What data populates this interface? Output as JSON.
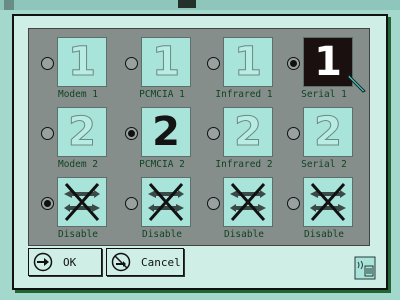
{
  "slots": [
    [
      {
        "label": "Modem 1",
        "digit": "1",
        "selected": false,
        "style": "outline"
      },
      {
        "label": "PCMCIA 1",
        "digit": "1",
        "selected": false,
        "style": "outline"
      },
      {
        "label": "Infrared 1",
        "digit": "1",
        "selected": false,
        "style": "outline"
      },
      {
        "label": "Serial 1",
        "digit": "1",
        "selected": true,
        "style": "highlighted"
      }
    ],
    [
      {
        "label": "Modem 2",
        "digit": "2",
        "selected": false,
        "style": "outline"
      },
      {
        "label": "PCMCIA 2",
        "digit": "2",
        "selected": true,
        "style": "solid"
      },
      {
        "label": "Infrared 2",
        "digit": "2",
        "selected": false,
        "style": "outline"
      },
      {
        "label": "Serial 2",
        "digit": "2",
        "selected": false,
        "style": "outline"
      }
    ],
    [
      {
        "label": "Disable",
        "selected": true,
        "icon": "disabled-port-icon"
      },
      {
        "label": "Disable",
        "selected": false,
        "icon": "disabled-port-icon"
      },
      {
        "label": "Disable",
        "selected": false,
        "icon": "disabled-port-icon"
      },
      {
        "label": "Disable",
        "selected": false,
        "icon": "disabled-port-icon"
      }
    ]
  ],
  "buttons": {
    "ok": {
      "label": "OK",
      "icon": "arrow-right-icon"
    },
    "cancel": {
      "label": "Cancel",
      "icon": "cancel-icon"
    }
  },
  "corner_icon": "infrared-port-icon",
  "colors": {
    "dialog_bg": "#cfeee6",
    "panel_bg": "#868e8c",
    "tile_bg": "#a8e4da",
    "tile_selected_bg": "#1a1010"
  }
}
